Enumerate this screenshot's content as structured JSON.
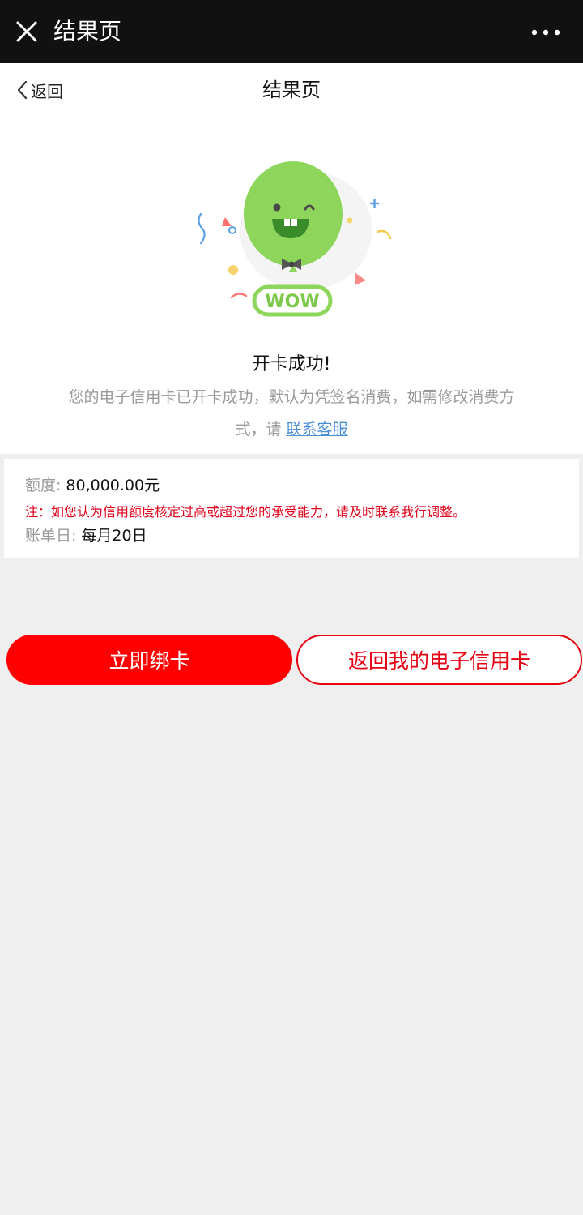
{
  "topbar": {
    "title": "结果页",
    "close_icon": "close-icon",
    "more_icon": "more-icon"
  },
  "navbar": {
    "back_label": "返回",
    "title": "结果页"
  },
  "result": {
    "illustration_text": "WOW",
    "title": "开卡成功!",
    "description": "您的电子信用卡已开卡成功，默认为凭签名消费，如需修改消费方式，请",
    "contact_link": "联系客服"
  },
  "info": {
    "limit_label": "额度:",
    "limit_value": "80,000.00元",
    "note": "注：如您认为信用额度核定过高或超过您的承受能力，请及时联系我行调整。",
    "bill_day_label": "账单日:",
    "bill_day_value": "每月20日"
  },
  "actions": {
    "bind_label": "立即绑卡",
    "return_label": "返回我的电子信用卡"
  },
  "colors": {
    "accent_red": "#ff0000",
    "link_blue": "#4a8fd6",
    "balloon_green": "#8dd65b"
  }
}
